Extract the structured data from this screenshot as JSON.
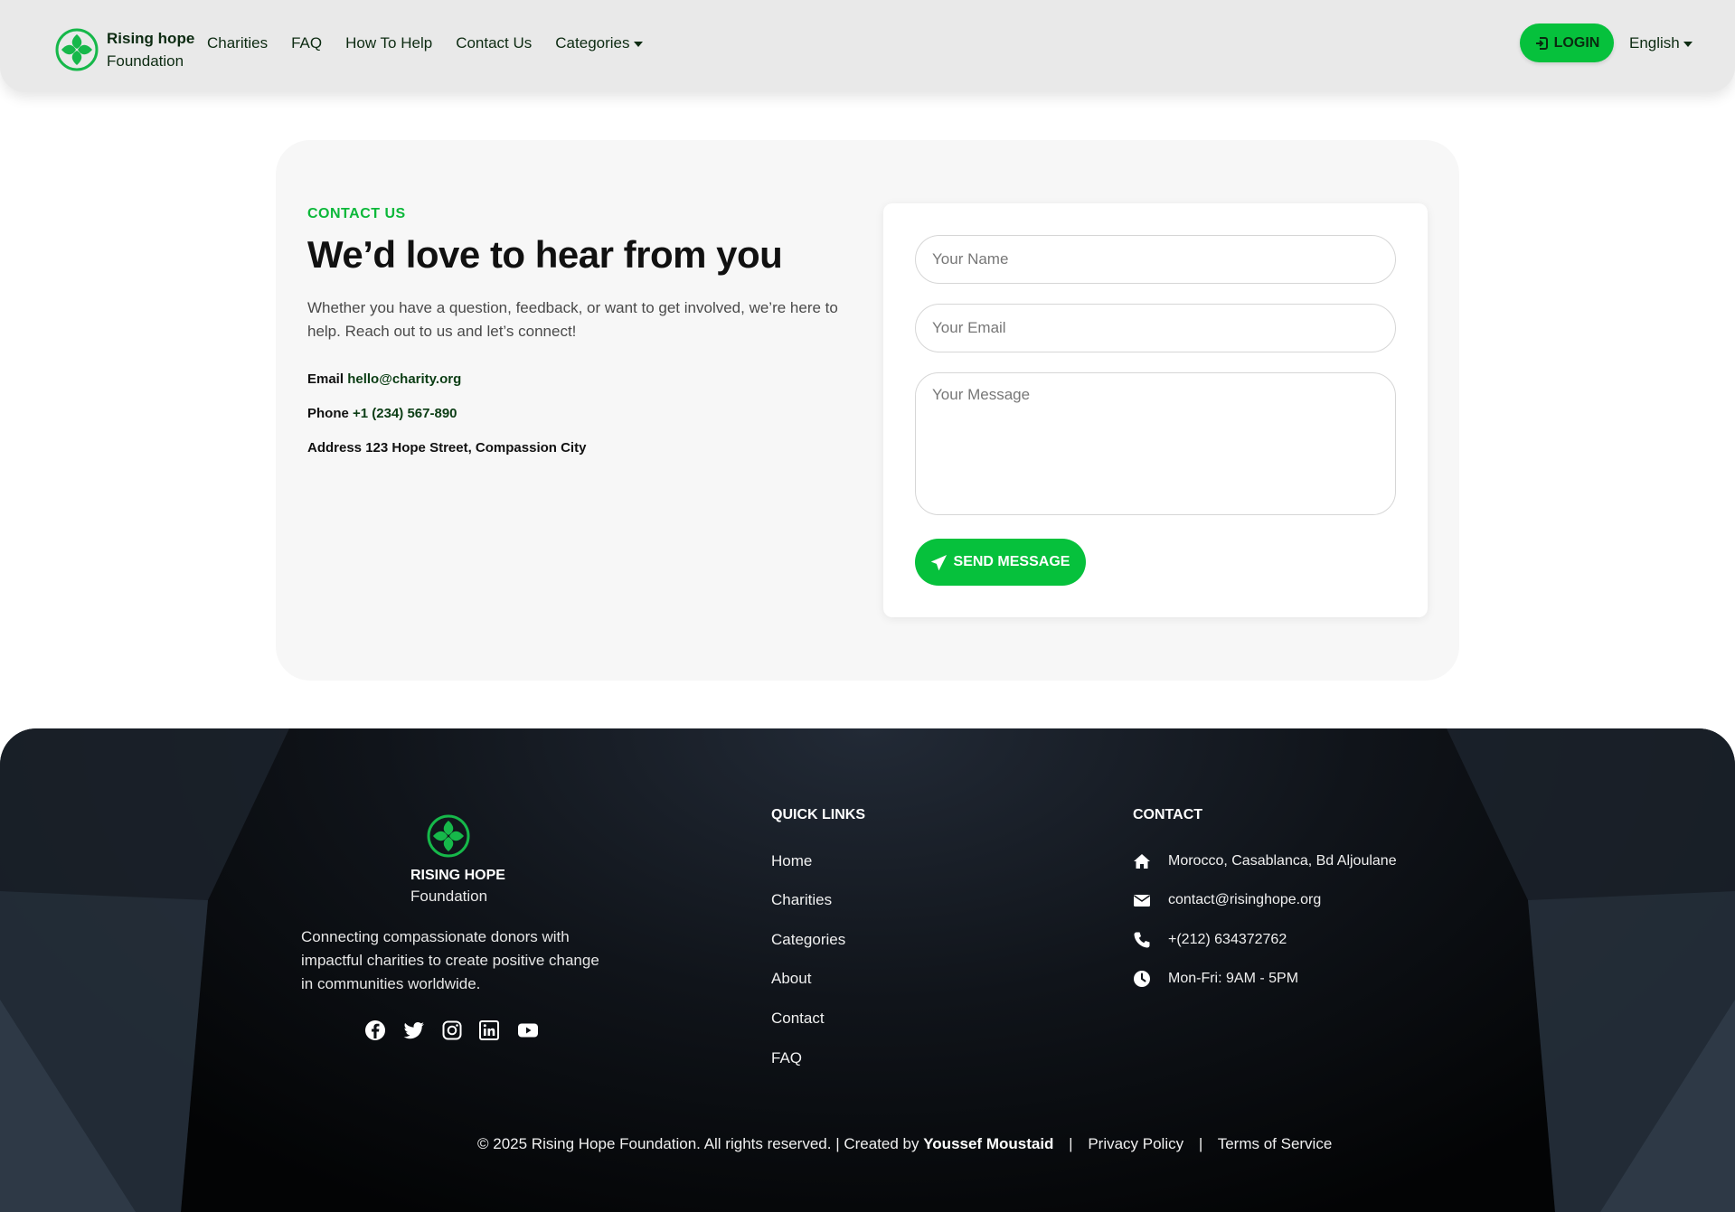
{
  "brand": {
    "name": "Rising hope",
    "sub": "Foundation",
    "logo_icon": "hands-circle-logo-icon"
  },
  "nav": {
    "links": [
      "Charities",
      "FAQ",
      "How To Help",
      "Contact Us",
      "Categories"
    ],
    "login_label": "LOGIN",
    "language": "English"
  },
  "contact": {
    "eyebrow": "CONTACT US",
    "headline": "We’d love to hear from you",
    "lead": "Whether you have a question, feedback, or want to get involved, we’re here to help. Reach out to us and let’s connect!",
    "email_label": "Email",
    "email_value": "hello@charity.org",
    "phone_label": "Phone",
    "phone_value": "+1 (234) 567-890",
    "address_label": "Address",
    "address_value": "123 Hope Street, Compassion City"
  },
  "form": {
    "name_placeholder": "Your Name",
    "email_placeholder": "Your Email",
    "message_placeholder": "Your Message",
    "send_label": "SEND MESSAGE"
  },
  "footer": {
    "brand_name": "RISING HOPE",
    "brand_sub": "Foundation",
    "description": "Connecting compassionate donors with impactful charities to create positive change in communities worldwide.",
    "social": [
      "facebook-icon",
      "twitter-icon",
      "instagram-icon",
      "linkedin-icon",
      "youtube-icon"
    ],
    "quick_links_title": "QUICK LINKS",
    "quick_links": [
      "Home",
      "Charities",
      "Categories",
      "About",
      "Contact",
      "FAQ"
    ],
    "contact_title": "CONTACT",
    "contact_items": [
      {
        "icon": "home-icon",
        "text": "Morocco, Casablanca, Bd Aljoulane"
      },
      {
        "icon": "envelope-icon",
        "text": "contact@risinghope.org"
      },
      {
        "icon": "phone-icon",
        "text": "+(212) 634372762"
      },
      {
        "icon": "clock-icon",
        "text": "Mon-Fri: 9AM - 5PM"
      }
    ],
    "copyright": "© 2025 Rising Hope Foundation. All rights reserved. | Created by",
    "creator": "Youssef Moustaid",
    "privacy": "Privacy Policy",
    "terms": "Terms of Service"
  },
  "colors": {
    "accent": "#06c13c",
    "dark_green": "#0d2b12"
  }
}
